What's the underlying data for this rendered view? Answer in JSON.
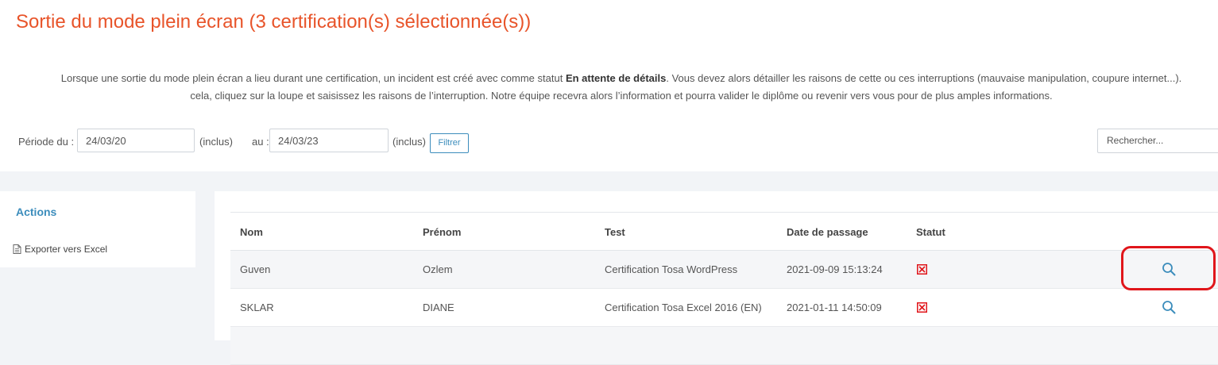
{
  "header": {
    "title": "Sortie du mode plein écran (3 certification(s) sélectionnée(s))"
  },
  "intro": {
    "line1_before": "Lorsque une sortie du mode plein écran a lieu durant une certification, un incident est créé avec comme statut ",
    "line1_bold": "En attente de détails",
    "line1_after": ". Vous devez alors détailler les raisons de cette ou ces interruptions (mauvaise manipulation, coupure internet...).",
    "line2": "cela, cliquez sur la loupe et saisissez les raisons de l’interruption. Notre équipe recevra alors l’information et pourra valider le diplôme ou revenir vers vous pour de plus amples informations."
  },
  "filters": {
    "period_from_label": "Période du :",
    "from_value": "24/03/20",
    "inclus_1": "(inclus)",
    "to_label": "au :",
    "to_value": "24/03/23",
    "inclus_2": "(inclus)",
    "filter_button": "Filtrer",
    "search_placeholder": "Rechercher..."
  },
  "actions": {
    "title": "Actions",
    "export_label": "Exporter vers Excel",
    "export_icon": "document-icon"
  },
  "table": {
    "columns": [
      "Nom",
      "Prénom",
      "Test",
      "Date de passage",
      "Statut"
    ],
    "rows": [
      {
        "nom": "Guven",
        "prenom": "Ozlem",
        "test": "Certification Tosa WordPress",
        "date": "2021-09-09 15:13:24",
        "status_icon": "error-x-icon",
        "action_icon": "search-icon"
      },
      {
        "nom": "SKLAR",
        "prenom": "DIANE",
        "test": "Certification Tosa Excel 2016 (EN)",
        "date": "2021-01-11 14:50:09",
        "status_icon": "error-x-icon",
        "action_icon": "search-icon"
      }
    ]
  },
  "colors": {
    "title": "#e8542a",
    "accent": "#3c8dbc",
    "status_error": "#e0161b",
    "highlight": "#e0161b"
  }
}
